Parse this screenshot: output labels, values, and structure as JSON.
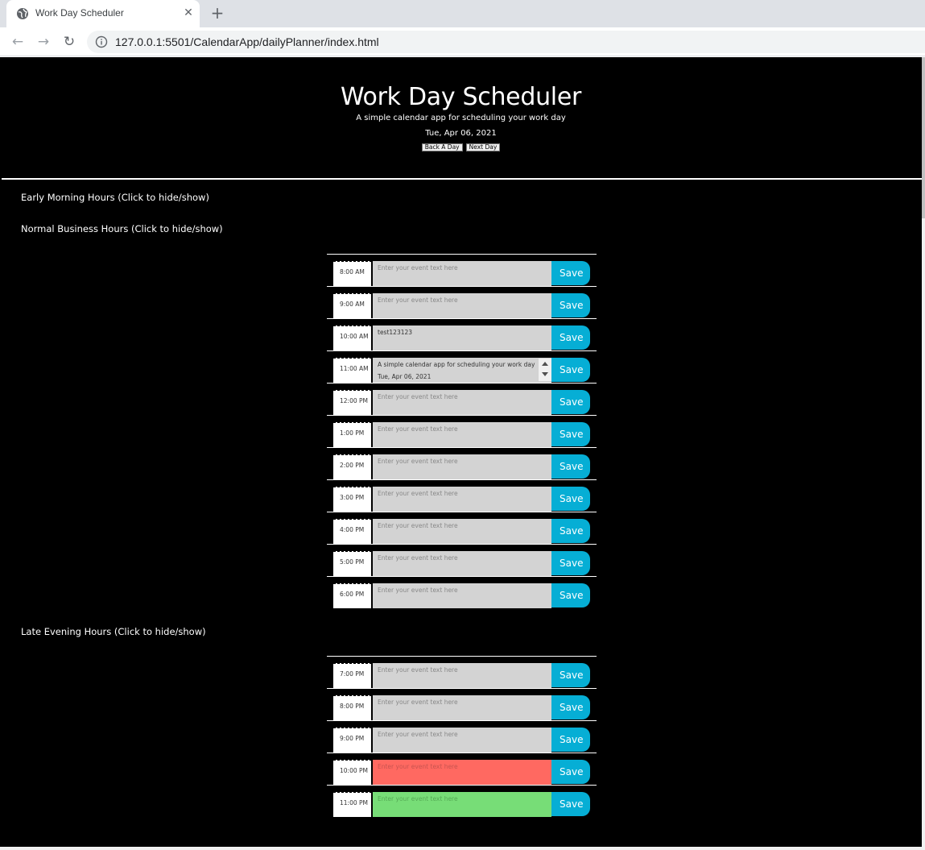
{
  "browser": {
    "tab_title": "Work Day Scheduler",
    "tab_close": "✕",
    "new_tab": "+",
    "url": "127.0.0.1:5501/CalendarApp/dailyPlanner/index.html",
    "back": "←",
    "forward": "→",
    "reload": "↻"
  },
  "header": {
    "title": "Work Day Scheduler",
    "subtitle": "A simple calendar app for scheduling your work day",
    "date": "Tue, Apr 06, 2021",
    "back_button": "Back A Day",
    "next_button": "Next Day"
  },
  "sections": {
    "early": "Early Morning Hours (Click to hide/show)",
    "normal": "Normal Business Hours (Click to hide/show)",
    "late": "Late Evening Hours (Click to hide/show)"
  },
  "placeholder": "Enter your event text here",
  "save_label": "Save",
  "business_hours": [
    {
      "hour": "8:00 AM",
      "text": "",
      "state": "present"
    },
    {
      "hour": "9:00 AM",
      "text": "",
      "state": "present"
    },
    {
      "hour": "10:00 AM",
      "text": "test123123",
      "state": "present"
    },
    {
      "hour": "11:00 AM",
      "text": "A simple calendar app for scheduling your work day\nTue, Apr 06, 2021",
      "state": "present"
    },
    {
      "hour": "12:00 PM",
      "text": "",
      "state": "present"
    },
    {
      "hour": "1:00 PM",
      "text": "",
      "state": "present"
    },
    {
      "hour": "2:00 PM",
      "text": "",
      "state": "present"
    },
    {
      "hour": "3:00 PM",
      "text": "",
      "state": "present"
    },
    {
      "hour": "4:00 PM",
      "text": "",
      "state": "present"
    },
    {
      "hour": "5:00 PM",
      "text": "",
      "state": "present"
    },
    {
      "hour": "6:00 PM",
      "text": "",
      "state": "present"
    }
  ],
  "evening_hours": [
    {
      "hour": "7:00 PM",
      "text": "",
      "state": "present"
    },
    {
      "hour": "8:00 PM",
      "text": "",
      "state": "present"
    },
    {
      "hour": "9:00 PM",
      "text": "",
      "state": "present"
    },
    {
      "hour": "10:00 PM",
      "text": "",
      "state": "past"
    },
    {
      "hour": "11:00 PM",
      "text": "",
      "state": "future"
    }
  ],
  "colors": {
    "page_bg": "#000000",
    "slot_default": "#d3d3d3",
    "slot_past": "#ff6961",
    "slot_future": "#77dd77",
    "save_button": "#06aed5"
  }
}
